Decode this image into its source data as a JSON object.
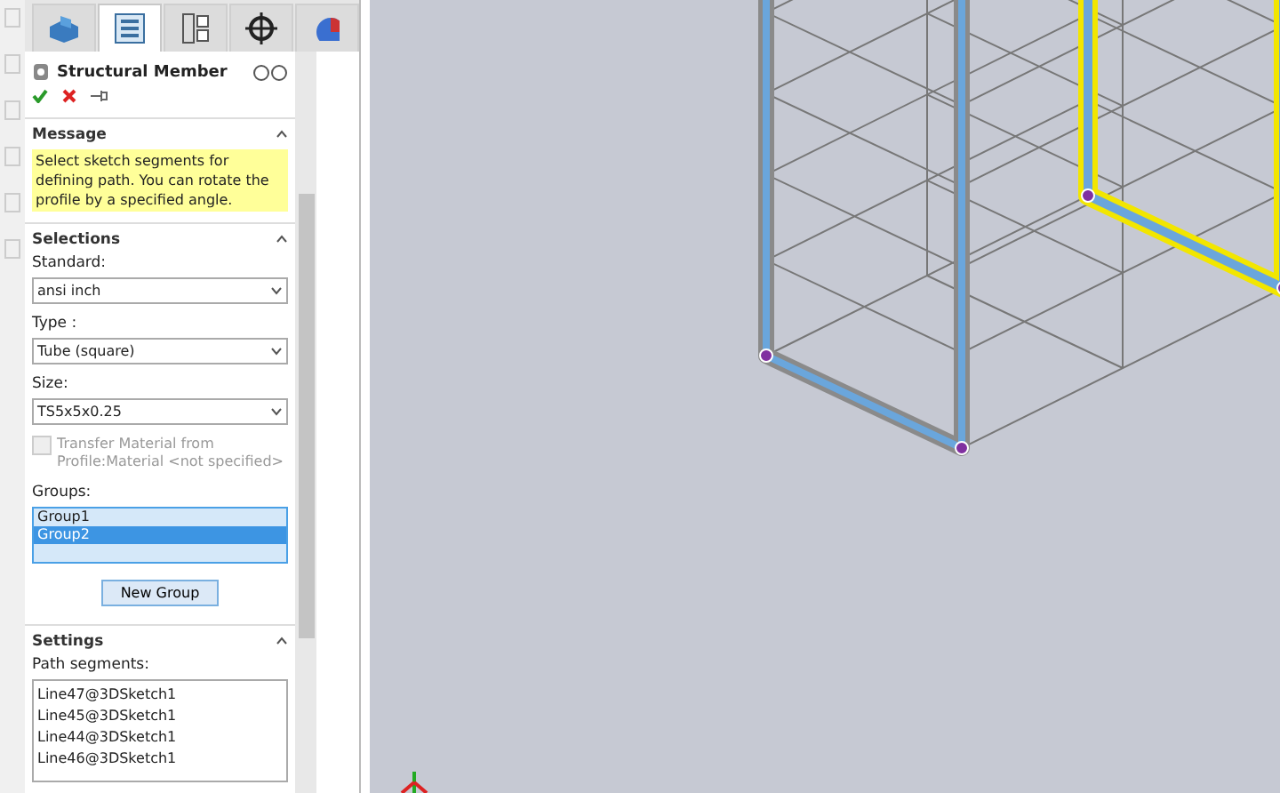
{
  "tabs": [
    {
      "kind": "feature-tree",
      "selected": false
    },
    {
      "kind": "property-manager",
      "selected": true
    },
    {
      "kind": "configuration",
      "selected": false
    },
    {
      "kind": "dimxpert",
      "selected": false
    },
    {
      "kind": "display",
      "selected": false
    }
  ],
  "panel": {
    "title": "Structural Member",
    "actions": [
      {
        "kind": "ok"
      },
      {
        "kind": "cancel"
      },
      {
        "kind": "pin"
      }
    ]
  },
  "message": {
    "heading": "Message",
    "text": "Select sketch segments for defining path. You can rotate the profile by a specified angle.",
    "expanded": true
  },
  "selections": {
    "heading": "Selections",
    "expanded": true,
    "fields": [
      {
        "label": "Standard:",
        "value": "ansi inch"
      },
      {
        "label": "Type :",
        "value": "Tube (square)"
      },
      {
        "label": "Size:",
        "value": "TS5x5x0.25"
      }
    ],
    "transfer_material": {
      "label": "Transfer Material from Profile:Material <not specified>",
      "checked": false,
      "disabled": true
    },
    "groups_label": "Groups:",
    "groups": [
      {
        "name": "Group1",
        "selected": false
      },
      {
        "name": "Group2",
        "selected": true
      }
    ],
    "new_group_button": "New Group"
  },
  "settings": {
    "heading": "Settings",
    "expanded": true,
    "path_label": "Path segments:",
    "path_segments": [
      "Line47@3DSketch1",
      "Line45@3DSketch1",
      "Line44@3DSketch1",
      "Line46@3DSketch1"
    ]
  }
}
